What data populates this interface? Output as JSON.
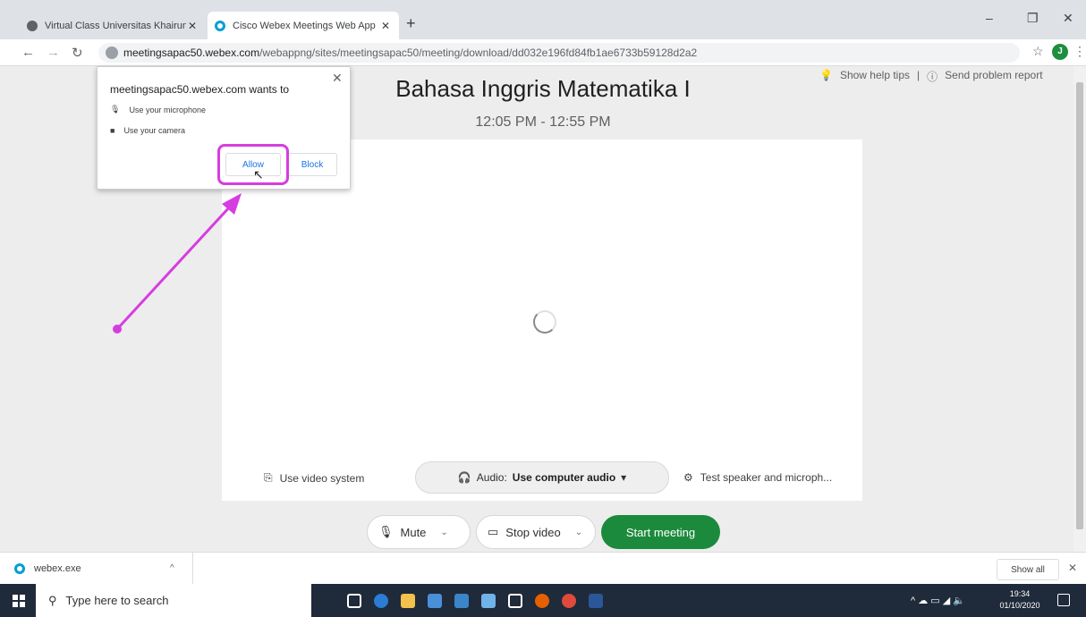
{
  "browser": {
    "tabs": [
      {
        "title": "Virtual Class Universitas Khairun",
        "active": false
      },
      {
        "title": "Cisco Webex Meetings Web App",
        "active": true
      }
    ],
    "url_host": "meetingsapac50.webex.com",
    "url_path": "/webappng/sites/meetingsapac50/meeting/download/dd032e196fd84fb1ae6733b59128d2a2",
    "avatar_letter": "J"
  },
  "permission_prompt": {
    "title": "meetingsapac50.webex.com wants to",
    "items": [
      "Use your microphone",
      "Use your camera"
    ],
    "allow_label": "Allow",
    "block_label": "Block",
    "highlight_color": "#d63de0"
  },
  "help": {
    "show_help_tips": "Show help tips",
    "separator": "|",
    "send_problem_report": "Send problem report"
  },
  "meeting": {
    "title": "Bahasa Inggris Matematika I",
    "time": "12:05 PM - 12:55 PM"
  },
  "controls": {
    "use_video_system": "Use video system",
    "audio_label": "Audio:",
    "audio_value": "Use computer audio",
    "test_speaker": "Test speaker and microph...",
    "mute": "Mute",
    "stop_video": "Stop video",
    "start_meeting": "Start meeting",
    "start_color": "#1c8a3c"
  },
  "downloads": {
    "file": "webex.exe",
    "show_all": "Show all"
  },
  "taskbar": {
    "search_placeholder": "Type here to search",
    "time": "19:34",
    "date": "01/10/2020"
  }
}
